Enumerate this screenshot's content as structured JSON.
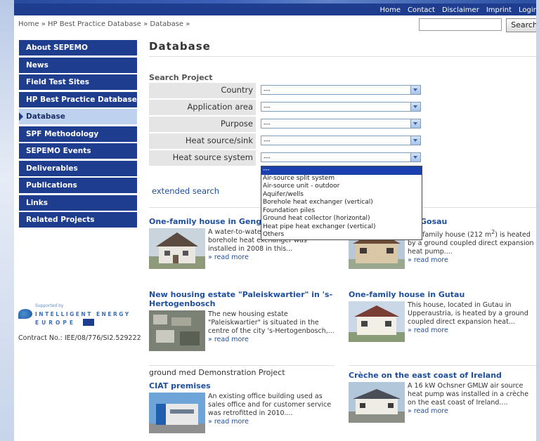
{
  "topnav": [
    "Home",
    "Contact",
    "Disclaimer",
    "Imprint",
    "Login"
  ],
  "breadcrumb": "Home » HP Best Practice Database » Database »",
  "search": {
    "button": "Search",
    "placeholder": ""
  },
  "sidebar": {
    "items": [
      {
        "label": "About SEPEMO"
      },
      {
        "label": "News"
      },
      {
        "label": "Field Test Sites"
      },
      {
        "label": "HP Best Practice Database"
      },
      {
        "label": "Database"
      },
      {
        "label": "SPF Methodology"
      },
      {
        "label": "SEPEMO Events"
      },
      {
        "label": "Deliverables"
      },
      {
        "label": "Publications"
      },
      {
        "label": "Links"
      },
      {
        "label": "Related Projects"
      }
    ],
    "active_index": 4
  },
  "supported": {
    "small": "Supported by",
    "line1": "INTELLIGENT ENERGY",
    "line2": "EUROPE",
    "contract": "Contract No.: IEE/08/776/SI2.529222"
  },
  "main": {
    "title": "Database",
    "search_label": "Search Project",
    "fields": [
      {
        "label": "Country",
        "value": "---"
      },
      {
        "label": "Application area",
        "value": "---"
      },
      {
        "label": "Purpose",
        "value": "---"
      },
      {
        "label": "Heat source/sink",
        "value": "---"
      },
      {
        "label": "Heat source system",
        "value": "---"
      }
    ],
    "dropdown_options": [
      "---",
      "Air-source split system",
      "Air-source unit - outdoor",
      "Aquifer/wells",
      "Borehole heat exchanger (vertical)",
      "Foundation piles",
      "Ground heat collector (horizontal)",
      "Heat pipe heat exchanger (vertical)",
      "Others"
    ],
    "extended_search": "extended search"
  },
  "cards": [
    {
      "title": "One-family house in Gengenbach",
      "text": "A water-to-water heat pump with a borehole heat exchanger was installed in 2008 in this...",
      "more": "» read more"
    },
    {
      "title": "Gosau",
      "text_pre": "one-family house (212 m",
      "sup": "2",
      "text_post": ") is heated by a ground coupled direct expansion heat pump....",
      "more": "» read more"
    },
    {
      "title": "New housing estate \"Paleiskwartier\" in 's-Hertogenbosch",
      "text": "The new housing estate \"Paleiskwartier\" is situated in the centre of the city 's-Hertogenbosch,...",
      "more": "» read more"
    },
    {
      "title": "One-family house in Gutau",
      "text": "This house, located in Gutau in Upperaustria, is heated by a ground coupled direct expansion heat...",
      "more": "» read more"
    },
    {
      "heading": "ground med Demonstration Project",
      "title": "CIAT premises",
      "text": "An existing office building used as sales office and for customer service was retrofitted in 2010....",
      "more": "» read more"
    },
    {
      "title": "Crèche on the east coast of Ireland",
      "text": "A 16 kW Ochsner GMLW air source heat pump was installed in a crèche on the east coast of Ireland....",
      "more": "» read more"
    }
  ]
}
